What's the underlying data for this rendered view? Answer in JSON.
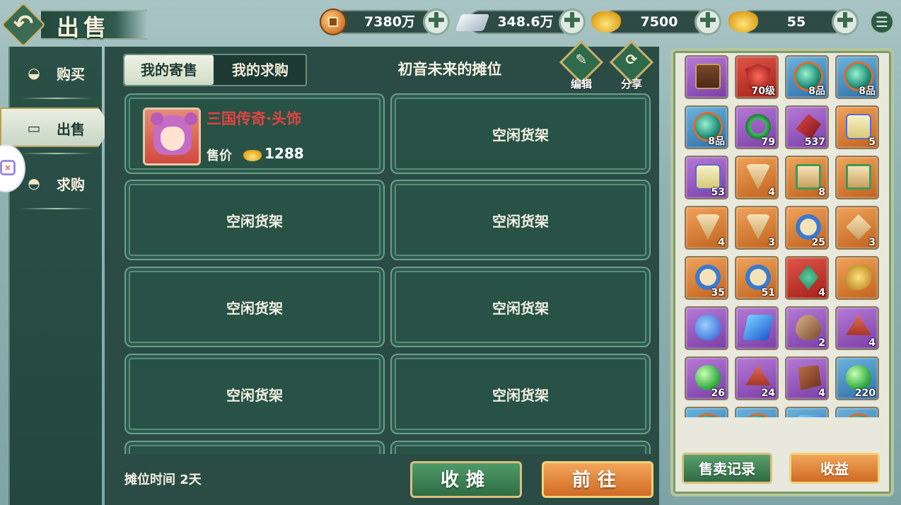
{
  "header": {
    "title": "出售",
    "resources": [
      {
        "name": "copper-coin",
        "value": "7380万"
      },
      {
        "name": "silver",
        "value": "348.6万"
      },
      {
        "name": "bound-gold",
        "value": "7500"
      },
      {
        "name": "gold-ingot",
        "value": "55"
      }
    ],
    "plus_glyph": "✚"
  },
  "side_nav": {
    "items": [
      {
        "label": "购买",
        "active": false
      },
      {
        "label": "出售",
        "active": true
      },
      {
        "label": "求购",
        "active": false
      }
    ]
  },
  "tabs": [
    {
      "label": "我的寄售",
      "active": true
    },
    {
      "label": "我的求购",
      "active": false
    }
  ],
  "stall": {
    "title": "初音未来的摊位",
    "edit_label": "编辑",
    "share_label": "分享",
    "time_label": "摊位时间 2天"
  },
  "shelves": [
    {
      "empty": false,
      "item_name": "三国传奇·头饰",
      "price_label": "售价",
      "price": "1288"
    },
    {
      "empty": true,
      "label": "空闲货架"
    },
    {
      "empty": true,
      "label": "空闲货架"
    },
    {
      "empty": true,
      "label": "空闲货架"
    },
    {
      "empty": true,
      "label": "空闲货架"
    },
    {
      "empty": true,
      "label": "空闲货架"
    },
    {
      "empty": true,
      "label": "空闲货架"
    },
    {
      "empty": true,
      "label": "空闲货架"
    },
    {
      "empty": true,
      "label": ""
    },
    {
      "empty": true,
      "label": ""
    }
  ],
  "buttons": {
    "close_stall": "收摊",
    "go_to": "前往",
    "sale_records": "售卖记录",
    "earnings": "收益"
  },
  "inventory": [
    {
      "art": "chest",
      "quality": "purple",
      "badge": ""
    },
    {
      "art": "mask",
      "quality": "red",
      "badge": "70级"
    },
    {
      "art": "orb",
      "quality": "blue",
      "badge": "8品"
    },
    {
      "art": "orb",
      "quality": "blue",
      "badge": "8品"
    },
    {
      "art": "orb",
      "quality": "blue",
      "badge": "8品"
    },
    {
      "art": "ring",
      "quality": "purple",
      "badge": "79"
    },
    {
      "art": "crystal",
      "quality": "purple",
      "badge": "537"
    },
    {
      "art": "scroll",
      "quality": "orange",
      "badge": "5"
    },
    {
      "art": "scroll",
      "quality": "purple",
      "badge": "53"
    },
    {
      "art": "tri",
      "quality": "orange",
      "badge": "4"
    },
    {
      "art": "card",
      "quality": "orange",
      "badge": "8"
    },
    {
      "art": "card",
      "quality": "orange",
      "badge": ""
    },
    {
      "art": "tri",
      "quality": "orange",
      "badge": "4"
    },
    {
      "art": "tri",
      "quality": "orange",
      "badge": "3"
    },
    {
      "art": "circle",
      "quality": "orange",
      "badge": "25"
    },
    {
      "art": "diamond",
      "quality": "orange",
      "badge": "3"
    },
    {
      "art": "circle",
      "quality": "orange",
      "badge": "35"
    },
    {
      "art": "circle",
      "quality": "orange",
      "badge": "51"
    },
    {
      "art": "amulet",
      "quality": "red",
      "badge": "4"
    },
    {
      "art": "gold",
      "quality": "orange",
      "badge": ""
    },
    {
      "art": "gem-blue",
      "quality": "purple",
      "badge": ""
    },
    {
      "art": "block-blue",
      "quality": "purple",
      "badge": ""
    },
    {
      "art": "seed",
      "quality": "purple",
      "badge": "2"
    },
    {
      "art": "pyramid",
      "quality": "purple",
      "badge": "4"
    },
    {
      "art": "pearl",
      "quality": "purple",
      "badge": "26"
    },
    {
      "art": "pyramid",
      "quality": "purple",
      "badge": "24"
    },
    {
      "art": "hide",
      "quality": "purple",
      "badge": "4"
    },
    {
      "art": "pearl",
      "quality": "blue",
      "badge": "220"
    },
    {
      "art": "orb",
      "quality": "blue",
      "badge": ""
    },
    {
      "art": "orb",
      "quality": "blue",
      "badge": ""
    },
    {
      "art": "block-blue",
      "quality": "blue",
      "badge": ""
    },
    {
      "art": "orb",
      "quality": "blue",
      "badge": ""
    }
  ],
  "colors": {
    "panel": "#2a4c44",
    "accent_gold": "#c7b06a",
    "item_name_red": "#e4433f"
  }
}
